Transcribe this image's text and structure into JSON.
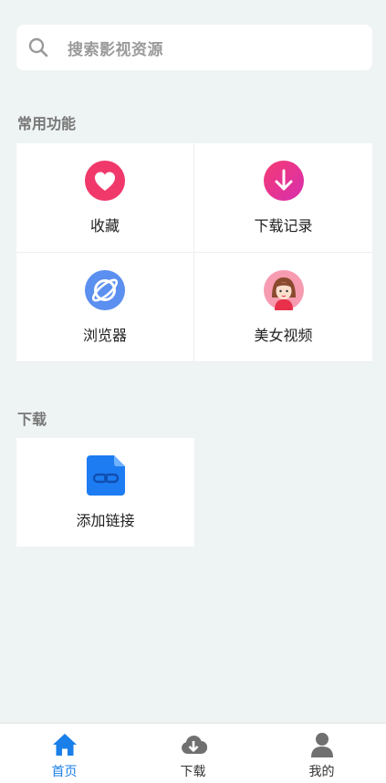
{
  "search": {
    "placeholder": "搜索影视资源"
  },
  "sections": {
    "common": {
      "title": "常用功能"
    },
    "download": {
      "title": "下载"
    }
  },
  "features": [
    {
      "label": "收藏",
      "icon": "heart-icon",
      "color": "#f0386b"
    },
    {
      "label": "下载记录",
      "icon": "download-arrow-icon",
      "color": "#e6348e"
    },
    {
      "label": "浏览器",
      "icon": "browser-planet-icon",
      "color": "#5b8ff0"
    },
    {
      "label": "美女视频",
      "icon": "girl-avatar-icon",
      "color": "#f79bb0"
    }
  ],
  "downloads": [
    {
      "label": "添加链接",
      "icon": "link-file-icon",
      "color": "#2e7bf0"
    }
  ],
  "tabs": [
    {
      "label": "首页",
      "icon": "home-icon",
      "active": true
    },
    {
      "label": "下载",
      "icon": "cloud-download-icon",
      "active": false
    },
    {
      "label": "我的",
      "icon": "user-icon",
      "active": false
    }
  ],
  "colors": {
    "accent": "#1a7fe8",
    "background": "#eef3f3",
    "tab_icon_inactive": "#707070"
  }
}
